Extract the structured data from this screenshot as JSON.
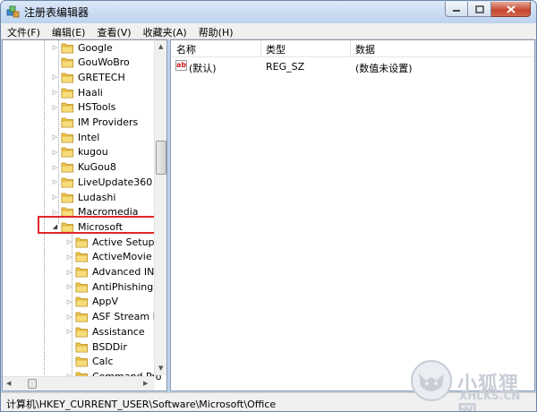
{
  "window": {
    "title": "注册表编辑器"
  },
  "menu": [
    "文件(F)",
    "编辑(E)",
    "查看(V)",
    "收藏夹(A)",
    "帮助(H)"
  ],
  "tree": [
    {
      "label": "Google",
      "depth": 1,
      "expander": "right"
    },
    {
      "label": "GouWoBro",
      "depth": 1,
      "expander": "none"
    },
    {
      "label": "GRETECH",
      "depth": 1,
      "expander": "right"
    },
    {
      "label": "Haali",
      "depth": 1,
      "expander": "right"
    },
    {
      "label": "HSTools",
      "depth": 1,
      "expander": "right"
    },
    {
      "label": "IM Providers",
      "depth": 1,
      "expander": "none"
    },
    {
      "label": "Intel",
      "depth": 1,
      "expander": "right"
    },
    {
      "label": "kugou",
      "depth": 1,
      "expander": "right"
    },
    {
      "label": "KuGou8",
      "depth": 1,
      "expander": "right"
    },
    {
      "label": "LiveUpdate360",
      "depth": 1,
      "expander": "right"
    },
    {
      "label": "Ludashi",
      "depth": 1,
      "expander": "right"
    },
    {
      "label": "Macromedia",
      "depth": 1,
      "expander": "right"
    },
    {
      "label": "Microsoft",
      "depth": 1,
      "expander": "down",
      "highlighted": true
    },
    {
      "label": "Active Setup",
      "depth": 2,
      "expander": "right"
    },
    {
      "label": "ActiveMovie",
      "depth": 2,
      "expander": "right"
    },
    {
      "label": "Advanced INF",
      "depth": 2,
      "expander": "right"
    },
    {
      "label": "AntiPhishing",
      "depth": 2,
      "expander": "right"
    },
    {
      "label": "AppV",
      "depth": 2,
      "expander": "right"
    },
    {
      "label": "ASF Stream De",
      "depth": 2,
      "expander": "right"
    },
    {
      "label": "Assistance",
      "depth": 2,
      "expander": "right"
    },
    {
      "label": "BSDDir",
      "depth": 2,
      "expander": "none"
    },
    {
      "label": "Calc",
      "depth": 2,
      "expander": "none"
    },
    {
      "label": "Command Pro",
      "depth": 2,
      "expander": "right"
    }
  ],
  "columns": {
    "name": "名称",
    "type": "类型",
    "data": "数据"
  },
  "values": [
    {
      "icon": "ab",
      "name": "(默认)",
      "type": "REG_SZ",
      "data": "(数值未设置)"
    }
  ],
  "status": {
    "path": "计算机\\HKEY_CURRENT_USER\\Software\\Microsoft\\Office"
  },
  "watermark": {
    "line1": "小狐狸网",
    "line2": "XHLKS.CN"
  },
  "colors": {
    "highlight_box": "#e0262b",
    "folder": "#f2c94c",
    "close_button": "#c6452e"
  },
  "icons": {
    "app": "registry-editor-icon",
    "folder": "folder-icon",
    "string_value": "string-value-icon"
  }
}
